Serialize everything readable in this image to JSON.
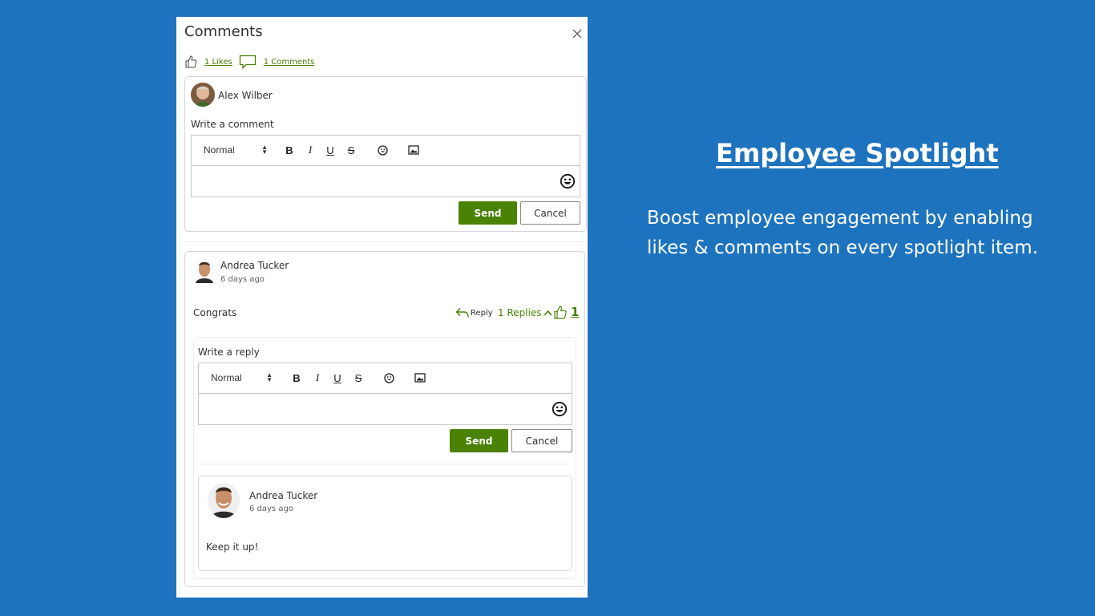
{
  "panel": {
    "title": "Comments",
    "likes_link": "1 Likes",
    "comments_link": "1 Comments"
  },
  "new_comment": {
    "user_name": "Alex Wilber",
    "label": "Write a comment",
    "format_select": "Normal",
    "send_label": "Send",
    "cancel_label": "Cancel"
  },
  "comment": {
    "author": "Andrea Tucker",
    "time": "6 days ago",
    "text": "Congrats",
    "reply_label": "Reply",
    "replies_label": "1 Replies",
    "like_count": "1"
  },
  "reply_editor": {
    "label": "Write a reply",
    "format_select": "Normal",
    "send_label": "Send",
    "cancel_label": "Cancel"
  },
  "reply": {
    "author": "Andrea Tucker",
    "time": "6 days ago",
    "text": "Keep it up!"
  },
  "promo": {
    "title": "Employee Spotlight",
    "body": "Boost employee engagement by enabling likes & comments on every spotlight item."
  },
  "toolbar_icons": [
    "bold-icon",
    "italic-icon",
    "underline-icon",
    "strikethrough-icon",
    "emoji-icon",
    "image-icon"
  ],
  "colors": {
    "background": "#1e73be",
    "accent": "#498205",
    "panel": "#ffffff"
  }
}
